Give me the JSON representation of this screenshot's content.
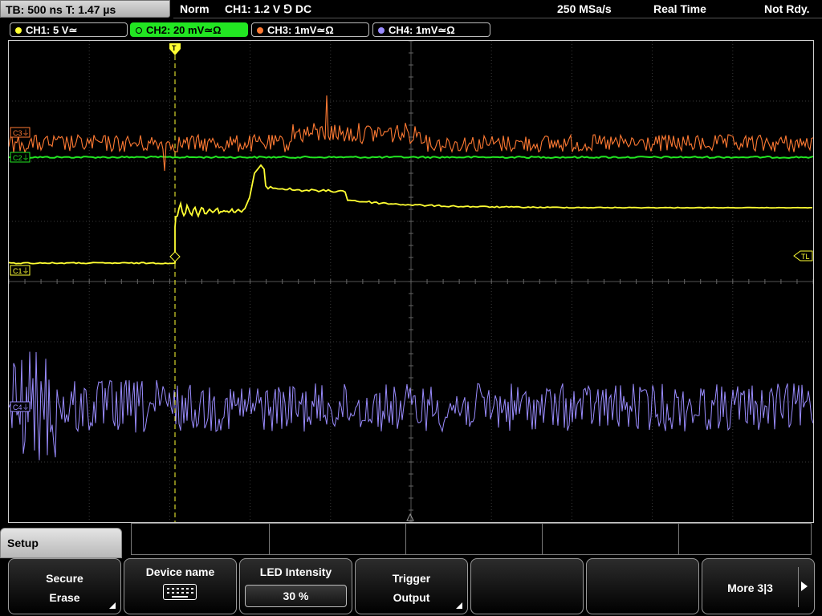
{
  "topbar": {
    "timebase": "TB: 500 ns   T: 1.47 µs",
    "mode": "Norm",
    "trigger": "CH1: 1.2 V ⅁ DC",
    "sample_rate": "250 MSa/s",
    "acq_mode": "Real Time",
    "status": "Not Rdy."
  },
  "channels": [
    {
      "label": "CH1: 5 V≃",
      "color": "#ffff33"
    },
    {
      "label": "CH2: 20 mV≃Ω",
      "color": "#22e622"
    },
    {
      "label": "CH3: 1mV≃Ω",
      "color": "#ff7a33"
    },
    {
      "label": "CH4: 1mV≃Ω",
      "color": "#9a8cff"
    }
  ],
  "markers": {
    "c1": "C1⏚",
    "c3": "C3⏚",
    "c2": "C2⏚",
    "c4": "C4⏚",
    "trigger_level": "TL",
    "trigger_pos": "T"
  },
  "menu": {
    "title": "Setup",
    "softkeys": [
      {
        "line1": "Secure",
        "line2": "Erase",
        "has_submenu": true
      },
      {
        "line1": "Device name",
        "icon": "keyboard-icon"
      },
      {
        "line1": "LED Intensity",
        "value": "30 %"
      },
      {
        "line1": "Trigger",
        "line2": "Output",
        "has_submenu": true
      },
      {
        "line1": ""
      },
      {
        "line1": ""
      },
      {
        "line1": "More 3|3"
      }
    ]
  },
  "colors": {
    "ch1": "#ffff33",
    "ch2": "#22e622",
    "ch3": "#ff7a33",
    "ch4": "#9a8cff",
    "grid": "#3a3a3a"
  }
}
